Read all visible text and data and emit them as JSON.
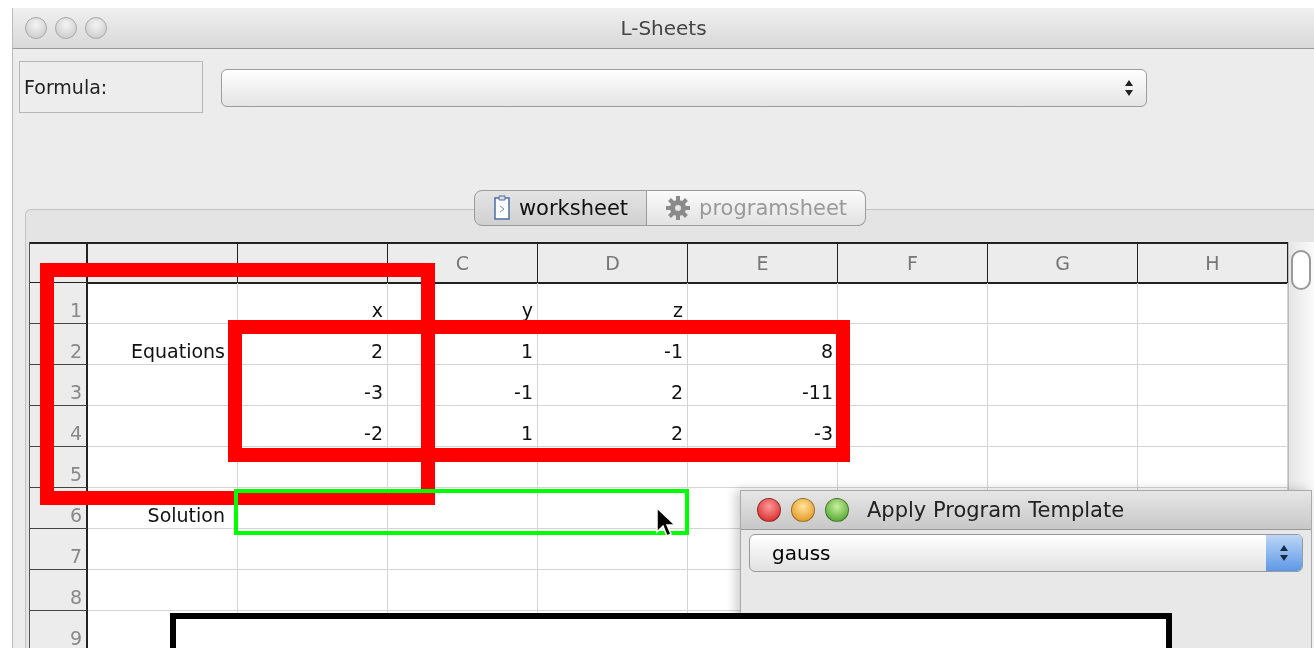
{
  "window": {
    "title": "L-Sheets"
  },
  "formula": {
    "label": "Formula:"
  },
  "tabs": [
    {
      "label": "worksheet",
      "selected": true,
      "kind": "document"
    },
    {
      "label": "programsheet",
      "selected": false,
      "kind": "gear"
    }
  ],
  "sheet": {
    "columns": [
      null,
      null,
      "C",
      "D",
      "E",
      "F",
      "G",
      "H"
    ],
    "rows": [
      {
        "number": "1",
        "cells": [
          null,
          "x",
          "y",
          "z"
        ]
      },
      {
        "number": "2",
        "cells": [
          "Equations",
          "2",
          "1",
          "-1",
          "8"
        ]
      },
      {
        "number": "3",
        "cells": [
          null,
          "-3",
          "-1",
          "2",
          "-11"
        ]
      },
      {
        "number": "4",
        "cells": [
          null,
          "-2",
          "1",
          "2",
          "-3"
        ]
      },
      {
        "number": "5"
      },
      {
        "number": "6",
        "cells": [
          "Solution"
        ]
      },
      {
        "number": "7"
      },
      {
        "number": "8"
      },
      {
        "number": "9"
      }
    ]
  },
  "dialog": {
    "title": "Apply Program Template",
    "template": {
      "value": "gauss"
    }
  },
  "markup": [
    {
      "kind": "frame",
      "color": "#ff0000"
    },
    {
      "kind": "frame",
      "color": "#ff0000"
    },
    {
      "kind": "selection",
      "color": "#00ff00"
    },
    {
      "kind": "blank-panel",
      "color": "#000000"
    }
  ]
}
